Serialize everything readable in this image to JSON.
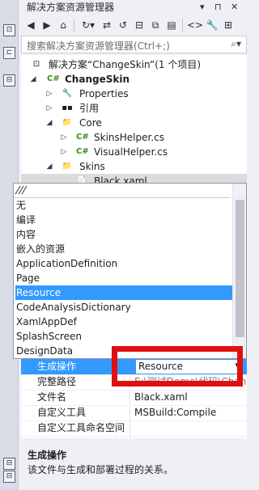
{
  "title_bar": {
    "title": "解决方案资源管理器"
  },
  "search": {
    "placeholder": "搜索解决方案资源管理器(Ctrl+;)"
  },
  "tree": {
    "solution": "解决方案“ChangeSkin”(1 个项目)",
    "project": "ChangeSkin",
    "items": [
      {
        "label": "Properties",
        "icon": "wrench-icon",
        "glyph": "🔧"
      },
      {
        "label": "引用",
        "icon": "references-icon",
        "glyph": "▪"
      },
      {
        "label": "Core",
        "icon": "folder-icon",
        "glyph": "📁"
      },
      {
        "label": "SkinsHelper.cs",
        "icon": "csharp-icon",
        "glyph": "C#"
      },
      {
        "label": "VisualHelper.cs",
        "icon": "csharp-icon",
        "glyph": "C#"
      },
      {
        "label": "Skins",
        "icon": "folder-icon",
        "glyph": "📁"
      },
      {
        "label": "Black.xaml",
        "icon": "xaml-icon",
        "glyph": "📄"
      }
    ]
  },
  "dropdown": {
    "options": [
      "无",
      "编译",
      "内容",
      "嵌入的资源",
      "ApplicationDefinition",
      "Page",
      "Resource",
      "CodeAnalysisDictionary",
      "XamlAppDef",
      "SplashScreen",
      "DesignData"
    ],
    "selected_index": 6
  },
  "properties": {
    "rows": [
      {
        "key": "生成操作",
        "value": "Resource"
      },
      {
        "key": "完整路径",
        "value": "E:\\测试Demo\\代码\\Chan"
      },
      {
        "key": "文件名",
        "value": "Black.xaml"
      },
      {
        "key": "自定义工具",
        "value": "MSBuild:Compile"
      },
      {
        "key": "自定义工具命名空间",
        "value": ""
      }
    ]
  },
  "description": {
    "title": "生成操作",
    "text": "该文件与生成和部署过程的关系。"
  },
  "colors": {
    "accent": "#3399ff",
    "highlight_box": "#e01010",
    "csharp": "#3e8a1c"
  }
}
